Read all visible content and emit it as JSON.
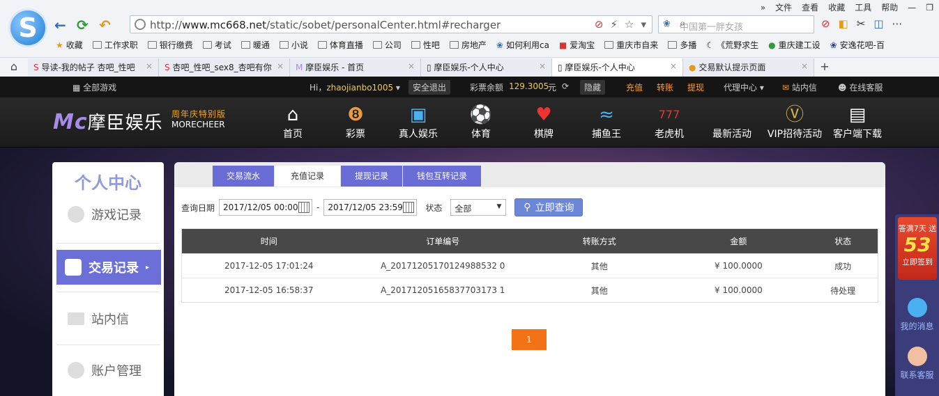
{
  "browser": {
    "menu": [
      "文件",
      "查看",
      "收藏",
      "工具",
      "帮助"
    ],
    "address": {
      "url_prefix": "http://",
      "url_domain": "www.mc668.net",
      "url_path": "/static/sobet/personalCenter.html#recharger"
    },
    "search_placeholder": "中国第一胖女孩",
    "bookmarks": [
      "收藏",
      "工作求职",
      "银行缴费",
      "考试",
      "暖通",
      "小说",
      "体育直播",
      "公司",
      "性吧",
      "房地产",
      "如何利用ca",
      "爱淘宝",
      "重庆市自来",
      "多播",
      "《荒野求生",
      "重庆建工设",
      "安逸花吧-百"
    ],
    "tabs": [
      {
        "label": "导读-我的帖子 杏吧_性吧"
      },
      {
        "label": "杏吧_性吧_sex8_杏吧有你"
      },
      {
        "label": "摩臣娱乐 - 首页"
      },
      {
        "label": "摩臣娱乐-个人中心"
      },
      {
        "label": "摩臣娱乐-个人中心"
      },
      {
        "label": "交易默认提示页面"
      }
    ]
  },
  "topbar": {
    "all_games": "全部游戏",
    "greeting": "Hi，",
    "username": "zhaojianbo1005",
    "logout": "安全退出",
    "balance_label": "彩票余额",
    "balance_value": "129.3005",
    "balance_unit": "元",
    "hide": "隐藏",
    "recharge": "充值",
    "transfer": "转账",
    "withdraw": "提现",
    "agent": "代理中心",
    "inbox": "站内信",
    "service": "在线客服"
  },
  "brand": {
    "m": "Mc",
    "name": "摩臣娱乐",
    "tagline": "周年庆特别版",
    "en": "MORECHEER"
  },
  "nav": [
    {
      "label": "首页",
      "icon": "home-icon",
      "glyph": "⌂"
    },
    {
      "label": "彩票",
      "icon": "lottery-ball-icon",
      "glyph": "❽"
    },
    {
      "label": "真人娱乐",
      "icon": "live-tv-icon",
      "glyph": "▣"
    },
    {
      "label": "体育",
      "icon": "football-icon",
      "glyph": "⚽"
    },
    {
      "label": "棋牌",
      "icon": "cards-icon",
      "glyph": "♥"
    },
    {
      "label": "捕鱼王",
      "icon": "fish-icon",
      "glyph": "≈"
    },
    {
      "label": "老虎机",
      "icon": "slot-machine-icon",
      "glyph": "777"
    },
    {
      "label": "最新活动",
      "icon": "",
      "glyph": ""
    },
    {
      "label": "VIP招待活动",
      "icon": "vip-icon",
      "glyph": "Ⓥ"
    },
    {
      "label": "客户端下载",
      "icon": "download-icon",
      "glyph": "▤"
    }
  ],
  "sidebar": {
    "title": "个人中心",
    "items": [
      {
        "label": "游戏记录"
      },
      {
        "label": "交易记录"
      },
      {
        "label": "站内信"
      },
      {
        "label": "账户管理"
      }
    ]
  },
  "panel": {
    "tabs": [
      "交易流水",
      "充值记录",
      "提现记录",
      "钱包互转记录"
    ],
    "filter": {
      "date_label": "查询日期",
      "start": "2017/12/05 00:00",
      "sep": "-",
      "end": "2017/12/05 23:59",
      "status_label": "状态",
      "status_value": "全部",
      "query": "立即查询"
    },
    "columns": [
      "时间",
      "订单编号",
      "转账方式",
      "金额",
      "状态"
    ],
    "rows": [
      [
        "2017-12-05 17:01:24",
        "A_20171205170124988532 0",
        "其他",
        "¥ 100.0000",
        "成功"
      ],
      [
        "2017-12-05 16:58:37",
        "A_20171205165837703173 1",
        "其他",
        "¥ 100.0000",
        "待处理"
      ]
    ],
    "page": "1"
  },
  "rightbar": {
    "sign_top": "答满7天 送",
    "sign_num": "53",
    "sign_btn": "立即签到",
    "messages": "我的消息",
    "service": "联系客服"
  }
}
